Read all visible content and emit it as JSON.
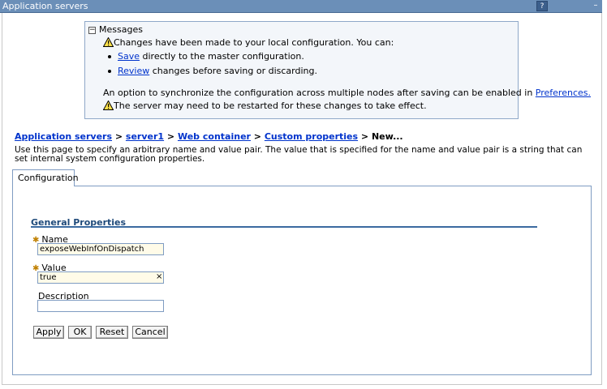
{
  "window": {
    "title": "Application servers",
    "help_label": "?",
    "minimize_label": "–"
  },
  "messages": {
    "title": "Messages",
    "changes_text": "Changes have been made to your local configuration. You can:",
    "save_link": "Save",
    "save_rest": " directly to the master configuration.",
    "review_link": "Review",
    "review_rest": " changes before saving or discarding.",
    "sync_text": "An option to synchronize the configuration across multiple nodes after saving can be enabled in ",
    "preferences_link": "Preferences.",
    "restart_text": "The server may need to be restarted for these changes to take effect."
  },
  "breadcrumb": {
    "items": [
      "Application servers",
      "server1",
      "Web container",
      "Custom properties"
    ],
    "separator": " > ",
    "current": "New..."
  },
  "description": "Use this page to specify an arbitrary name and value pair. The value that is specified for the name and value pair is a string that can set internal system configuration properties.",
  "tab": {
    "label": "Configuration"
  },
  "general_properties": {
    "title": "General Properties",
    "name_label": "Name",
    "name_value": "exposeWebInfOnDispatch",
    "value_label": "Value",
    "value_value": "true",
    "value_clear": "×",
    "description_label": "Description",
    "description_value": "",
    "required_marker": "✱"
  },
  "buttons": {
    "apply": "Apply",
    "ok": "OK",
    "reset": "Reset",
    "cancel": "Cancel"
  },
  "colors": {
    "titlebar": "#6b8fb8",
    "link": "#0033cc",
    "message_bg": "#f3f6fa",
    "section_title": "#1f4a7a",
    "required_field_bg": "#fffbe8"
  }
}
